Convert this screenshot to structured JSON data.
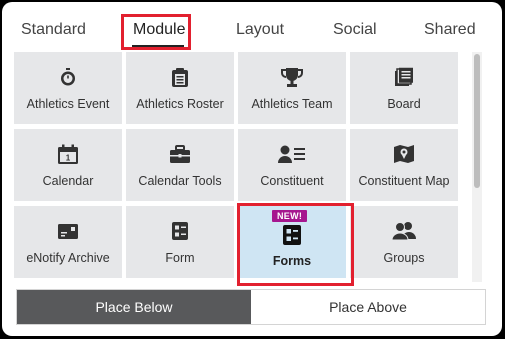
{
  "tabs": [
    "Standard",
    "Module",
    "Layout",
    "Social",
    "Shared"
  ],
  "active_tab": "Module",
  "tiles": [
    {
      "label": "Athletics Event",
      "icon": "stopwatch-icon"
    },
    {
      "label": "Athletics Roster",
      "icon": "clipboard-list-icon"
    },
    {
      "label": "Athletics Team",
      "icon": "trophy-icon"
    },
    {
      "label": "Board",
      "icon": "stacked-documents-icon"
    },
    {
      "label": "Calendar",
      "icon": "calendar-icon"
    },
    {
      "label": "Calendar Tools",
      "icon": "toolbox-icon"
    },
    {
      "label": "Constituent",
      "icon": "person-card-icon"
    },
    {
      "label": "Constituent Map",
      "icon": "map-pin-icon"
    },
    {
      "label": "eNotify Archive",
      "icon": "envelope-archive-icon"
    },
    {
      "label": "Form",
      "icon": "form-icon"
    },
    {
      "label": "Forms",
      "icon": "forms-icon",
      "badge": "NEW!",
      "selected": true
    },
    {
      "label": "Groups",
      "icon": "people-group-icon"
    }
  ],
  "buttons": {
    "place_below": "Place Below",
    "place_above": "Place Above"
  },
  "colors": {
    "highlight": "#e2202f",
    "badge": "#a6168f",
    "selected_tile": "#cfe5f3",
    "tile": "#e6e7e9",
    "active_button": "#58595b"
  }
}
